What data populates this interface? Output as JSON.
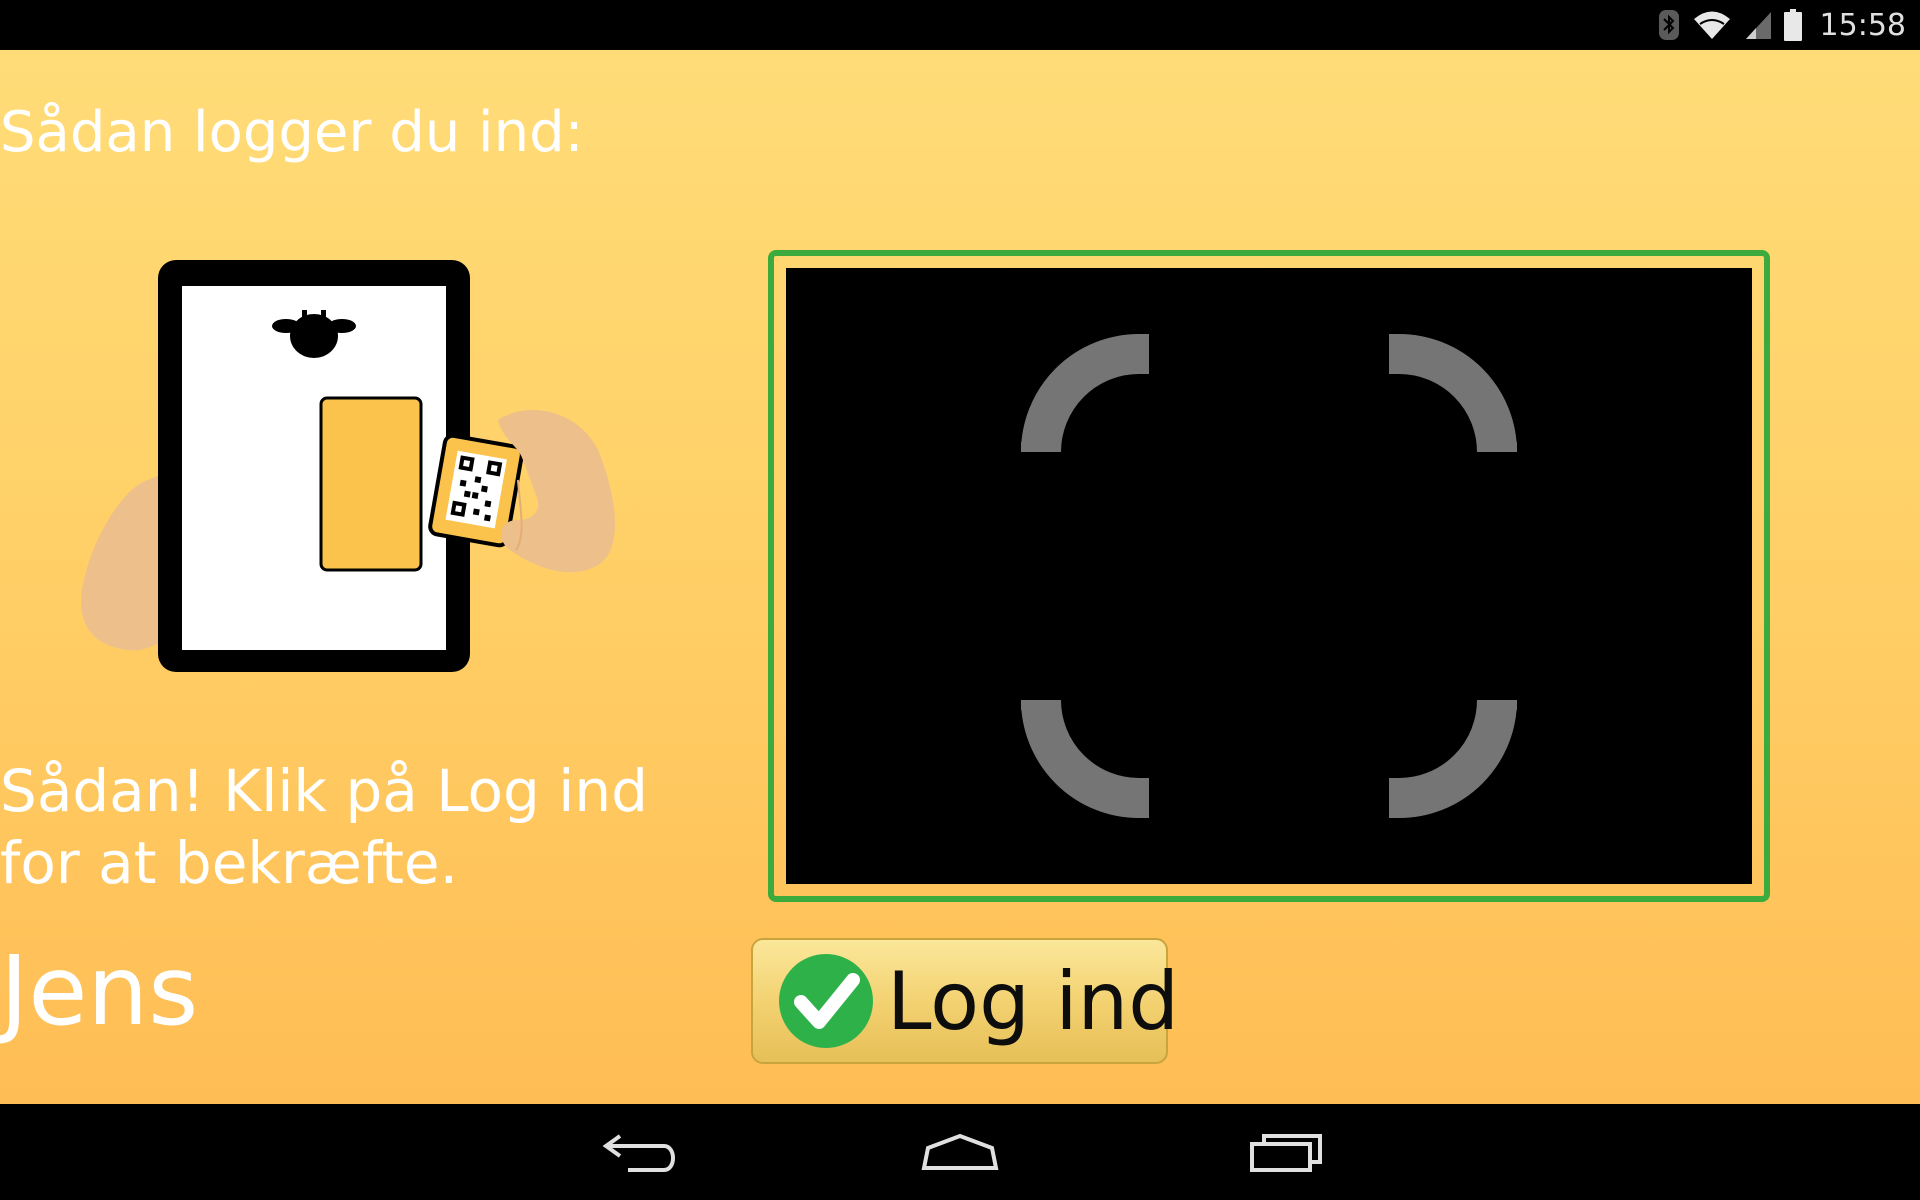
{
  "status_bar": {
    "time": "15:58",
    "icons": [
      "bluetooth-icon",
      "wifi-icon",
      "signal-icon",
      "battery-icon"
    ]
  },
  "instructions": {
    "title": "Sådan logger du ind:",
    "confirm_text": "Sådan! Klik på Log ind for at bekræfte."
  },
  "user": {
    "name": "Jens"
  },
  "login_button": {
    "label": "Log ind"
  },
  "navigation": {
    "buttons": [
      "back-icon",
      "home-icon",
      "recent-apps-icon"
    ]
  },
  "colors": {
    "background_top": "#ffdc78",
    "background_bottom": "#ffbd55",
    "frame_border": "#3caa3c",
    "scan_guide": "#757575",
    "checkmark_green": "#2fb14a"
  }
}
